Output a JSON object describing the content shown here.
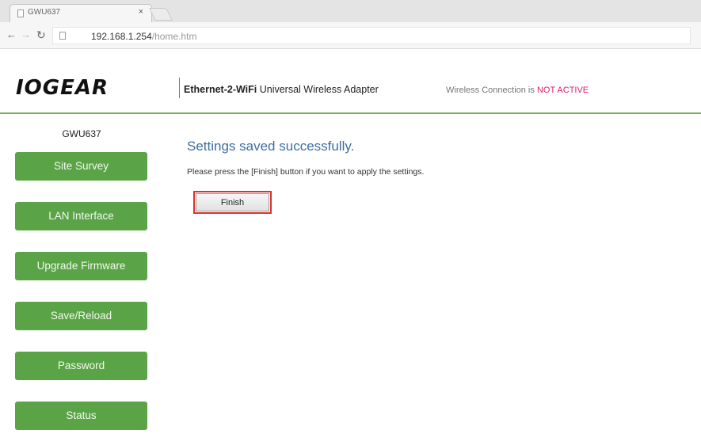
{
  "browser": {
    "tab_title": "GWU637",
    "tab_close": "×",
    "url_host": "192.168.1.254",
    "url_path": "/home.htm",
    "icons": {
      "back": "back-arrow-icon",
      "forward": "forward-arrow-icon",
      "reload": "reload-icon"
    }
  },
  "header": {
    "logo_text": "IOGEAR",
    "product_bold": "Ethernet-2-WiFi",
    "product_rest": " Universal Wireless Adapter",
    "status_prefix": "Wireless Connection is ",
    "status_value": "NOT ACTIVE",
    "colors": {
      "accent_green": "#5aa447",
      "rule_green": "#7cb05a",
      "alert_pink": "#e0206a"
    }
  },
  "sidebar": {
    "device_name": "GWU637",
    "items": [
      {
        "label": "Site Survey"
      },
      {
        "label": "LAN Interface"
      },
      {
        "label": "Upgrade Firmware"
      },
      {
        "label": "Save/Reload"
      },
      {
        "label": "Password"
      },
      {
        "label": "Status"
      }
    ]
  },
  "main": {
    "title": "Settings saved successfully.",
    "message": "Please press the [Finish] button if you want to apply the settings.",
    "finish_label": "Finish"
  }
}
